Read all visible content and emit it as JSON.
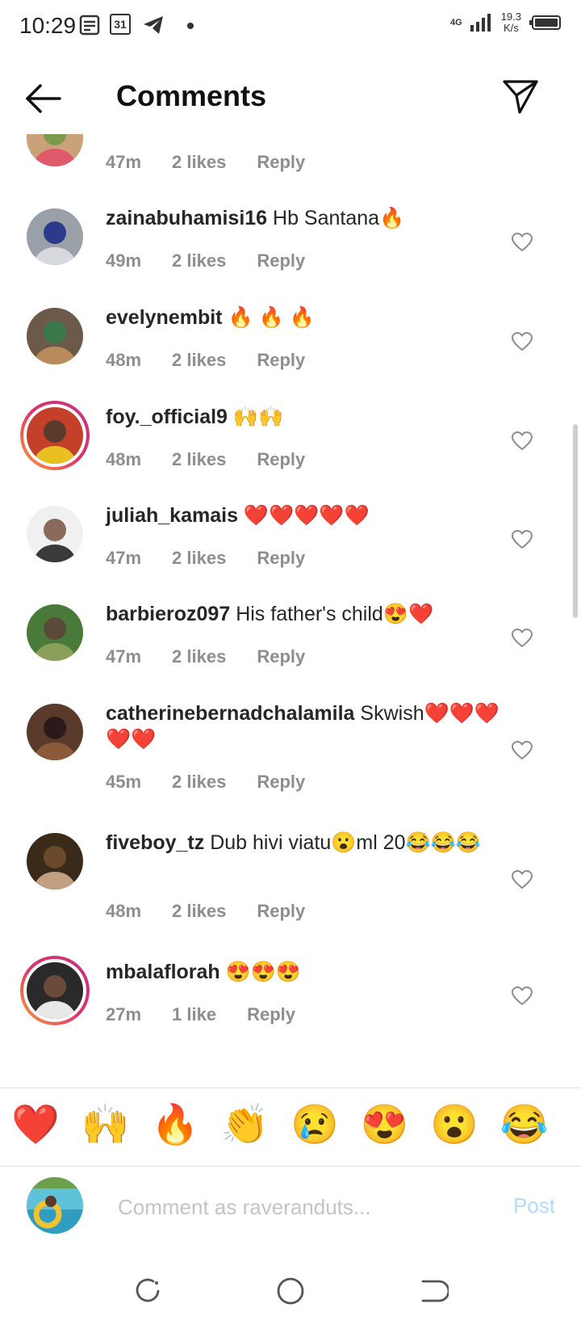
{
  "status_bar": {
    "time": "10:29",
    "calendar_day": "31",
    "network": "4G",
    "speed_value": "19.3",
    "speed_unit": "K/s"
  },
  "header": {
    "title": "Comments"
  },
  "comments": [
    {
      "username": "",
      "text": "",
      "time": "47m",
      "likes": "2 likes",
      "reply": "Reply",
      "story": false,
      "colors": [
        "#c9a27a",
        "#e05a6b",
        "#7a9a4a"
      ]
    },
    {
      "username": "zainabuhamisi16",
      "text": "Hb Santana🔥",
      "time": "49m",
      "likes": "2 likes",
      "reply": "Reply",
      "story": false,
      "colors": [
        "#9aa0a8",
        "#d7d9de",
        "#2b3a8a"
      ]
    },
    {
      "username": "evelynembit",
      "text": "🔥 🔥 🔥",
      "time": "48m",
      "likes": "2 likes",
      "reply": "Reply",
      "story": false,
      "colors": [
        "#6b5a4a",
        "#b98a5a",
        "#3a7a4a"
      ]
    },
    {
      "username": "foy._official9",
      "text": "🙌🙌",
      "time": "48m",
      "likes": "2 likes",
      "reply": "Reply",
      "story": true,
      "colors": [
        "#c4402a",
        "#e8c020",
        "#5a3a2a"
      ]
    },
    {
      "username": "juliah_kamais",
      "text": "❤️❤️❤️❤️❤️",
      "time": "47m",
      "likes": "2 likes",
      "reply": "Reply",
      "story": false,
      "colors": [
        "#f0f0f0",
        "#3a3a3a",
        "#8a6a5a"
      ]
    },
    {
      "username": "barbieroz097",
      "text": "His father's child😍❤️",
      "time": "47m",
      "likes": "2 likes",
      "reply": "Reply",
      "story": false,
      "colors": [
        "#4a7a3a",
        "#8aa05a",
        "#5a4a3a"
      ]
    },
    {
      "username": "catherinebernadchalamila",
      "text": "Skwish❤️❤️❤️❤️❤️",
      "time": "45m",
      "likes": "2 likes",
      "reply": "Reply",
      "story": false,
      "colors": [
        "#5a3a2a",
        "#8a5a3a",
        "#2a1a1a"
      ]
    },
    {
      "username": "fiveboy_tz",
      "text": "Dub hivi viatu😮ml 20😂😂😂",
      "time": "48m",
      "likes": "2 likes",
      "reply": "Reply",
      "story": false,
      "colors": [
        "#3a2a1a",
        "#c0a080",
        "#6a4a2a"
      ]
    },
    {
      "username": "mbalaflorah",
      "text": "😍😍😍",
      "time": "27m",
      "likes": "1 like",
      "reply": "Reply",
      "story": true,
      "colors": [
        "#2a2a2a",
        "#e8e8e8",
        "#6a4a3a"
      ]
    }
  ],
  "emoji_bar": [
    "❤️",
    "🙌",
    "🔥",
    "👏",
    "😢",
    "😍",
    "😮",
    "😂"
  ],
  "composer": {
    "placeholder": "Comment as raveranduts...",
    "post_label": "Post"
  },
  "colors": {
    "link": "#b3dbff",
    "meta": "#8e8e8e",
    "heart": "#8e8e8e",
    "story_ring_start": "#f9a13a",
    "story_ring_end": "#c13584"
  }
}
